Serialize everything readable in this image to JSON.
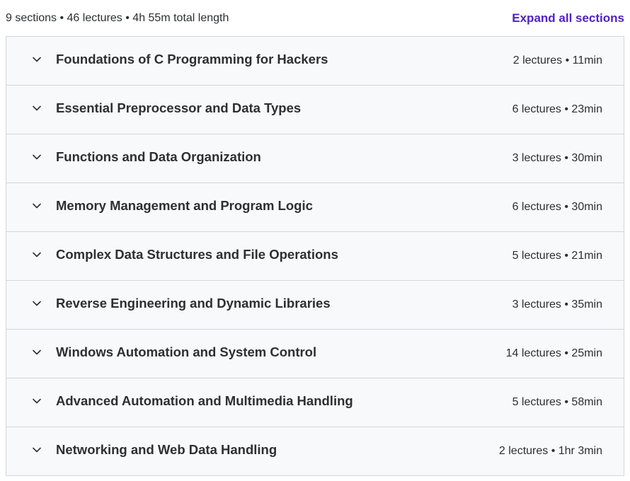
{
  "header": {
    "summary": "9 sections • 46 lectures • 4h 55m total length",
    "expand_all_label": "Expand all sections"
  },
  "icons": {
    "section_toggle": "chevron-down-icon"
  },
  "colors": {
    "accent": "#5022c3",
    "section_bg": "#f7f9fa",
    "border": "#d1d7dc",
    "text": "#2d2f31"
  },
  "sections": [
    {
      "title": "Foundations of C Programming for Hackers",
      "meta": "2 lectures • 11min"
    },
    {
      "title": "Essential Preprocessor and Data Types",
      "meta": "6 lectures • 23min"
    },
    {
      "title": "Functions and Data Organization",
      "meta": "3 lectures • 30min"
    },
    {
      "title": "Memory Management and Program Logic",
      "meta": "6 lectures • 30min"
    },
    {
      "title": "Complex Data Structures and File Operations",
      "meta": "5 lectures • 21min"
    },
    {
      "title": "Reverse Engineering and Dynamic Libraries",
      "meta": "3 lectures • 35min"
    },
    {
      "title": "Windows Automation and System Control",
      "meta": "14 lectures • 25min"
    },
    {
      "title": "Advanced Automation and Multimedia Handling",
      "meta": "5 lectures • 58min"
    },
    {
      "title": "Networking and Web Data Handling",
      "meta": "2 lectures • 1hr 3min"
    }
  ]
}
